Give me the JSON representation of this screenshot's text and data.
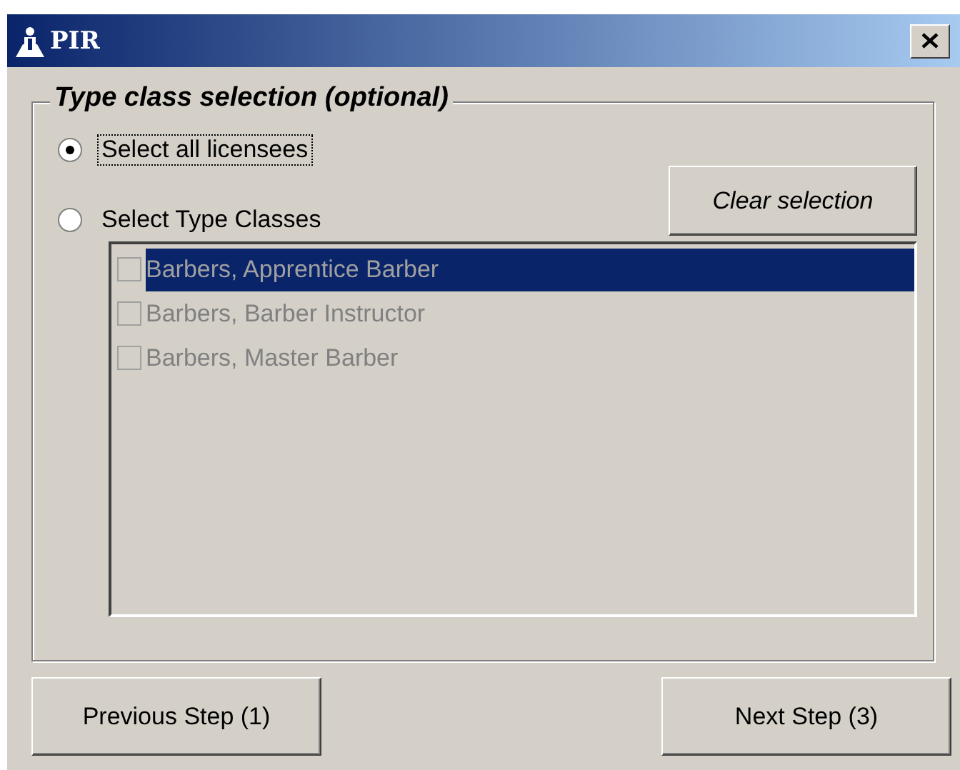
{
  "window": {
    "title": "PIR"
  },
  "group": {
    "title": "Type class selection (optional)"
  },
  "radios": [
    {
      "label": "Select all licensees",
      "selected": true,
      "focused": true
    },
    {
      "label": "Select Type Classes",
      "selected": false,
      "focused": false
    }
  ],
  "clear_button": {
    "label": "Clear selection"
  },
  "type_classes": {
    "disabled": true,
    "items": [
      {
        "label": "Barbers, Apprentice Barber",
        "checked": false,
        "selected": true
      },
      {
        "label": "Barbers, Barber Instructor",
        "checked": false,
        "selected": false
      },
      {
        "label": "Barbers, Master Barber",
        "checked": false,
        "selected": false
      }
    ]
  },
  "buttons": [
    {
      "label": "Previous Step (1)"
    },
    {
      "label": "Next Step (3)"
    }
  ]
}
